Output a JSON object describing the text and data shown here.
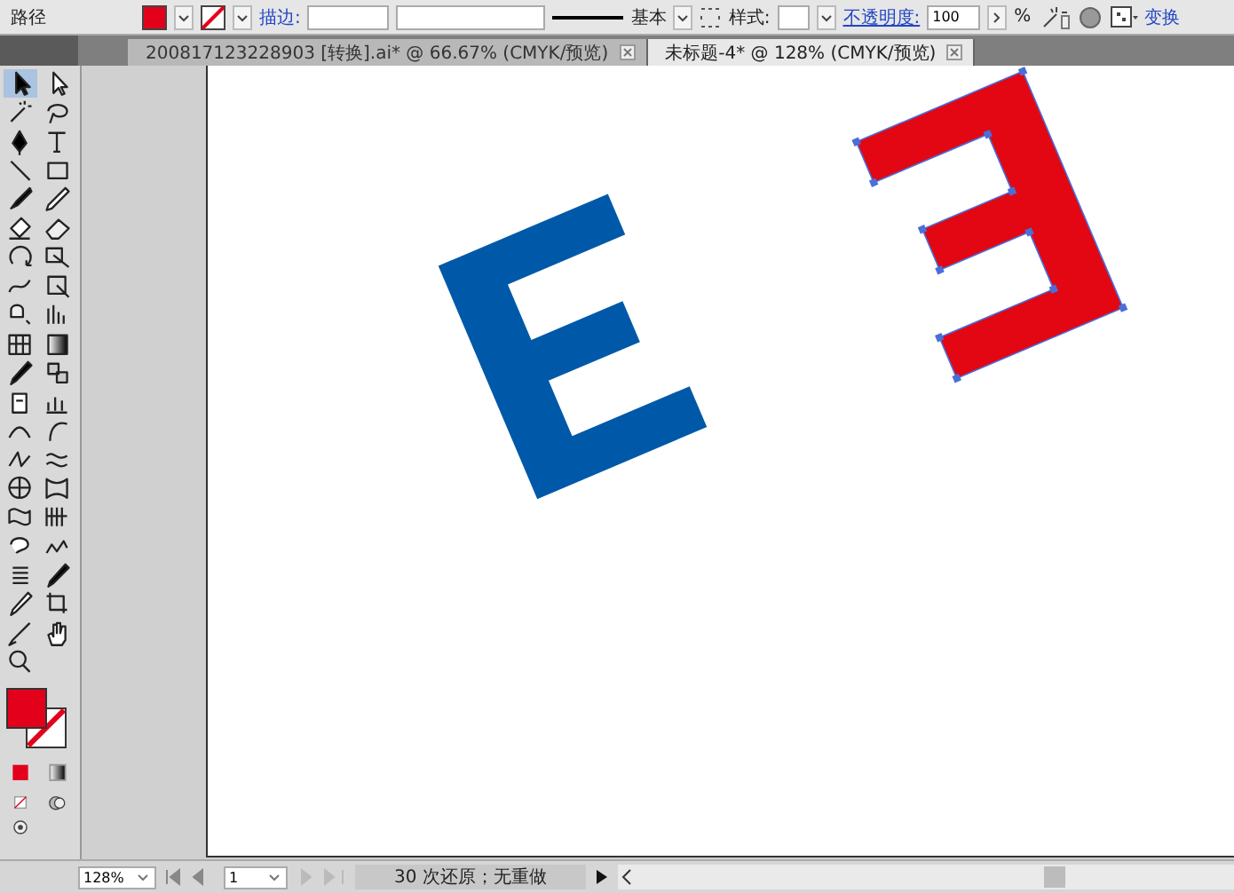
{
  "control_bar": {
    "label": "路径",
    "stroke_label": "描边:",
    "stroke_profile": "基本",
    "style_label": "样式:",
    "opacity_label": "不透明度:",
    "opacity_value": "100",
    "opacity_unit": "%",
    "transform_link": "变换"
  },
  "tabs": [
    {
      "label": "200817123228903 [转换].ai* @ 66.67% (CMYK/预览)",
      "selected": false
    },
    {
      "label": "未标题-4* @ 128% (CMYK/预览)",
      "selected": true
    }
  ],
  "status_bar": {
    "zoom": "128%",
    "page": "1",
    "message": "30 次还原；无重做"
  }
}
